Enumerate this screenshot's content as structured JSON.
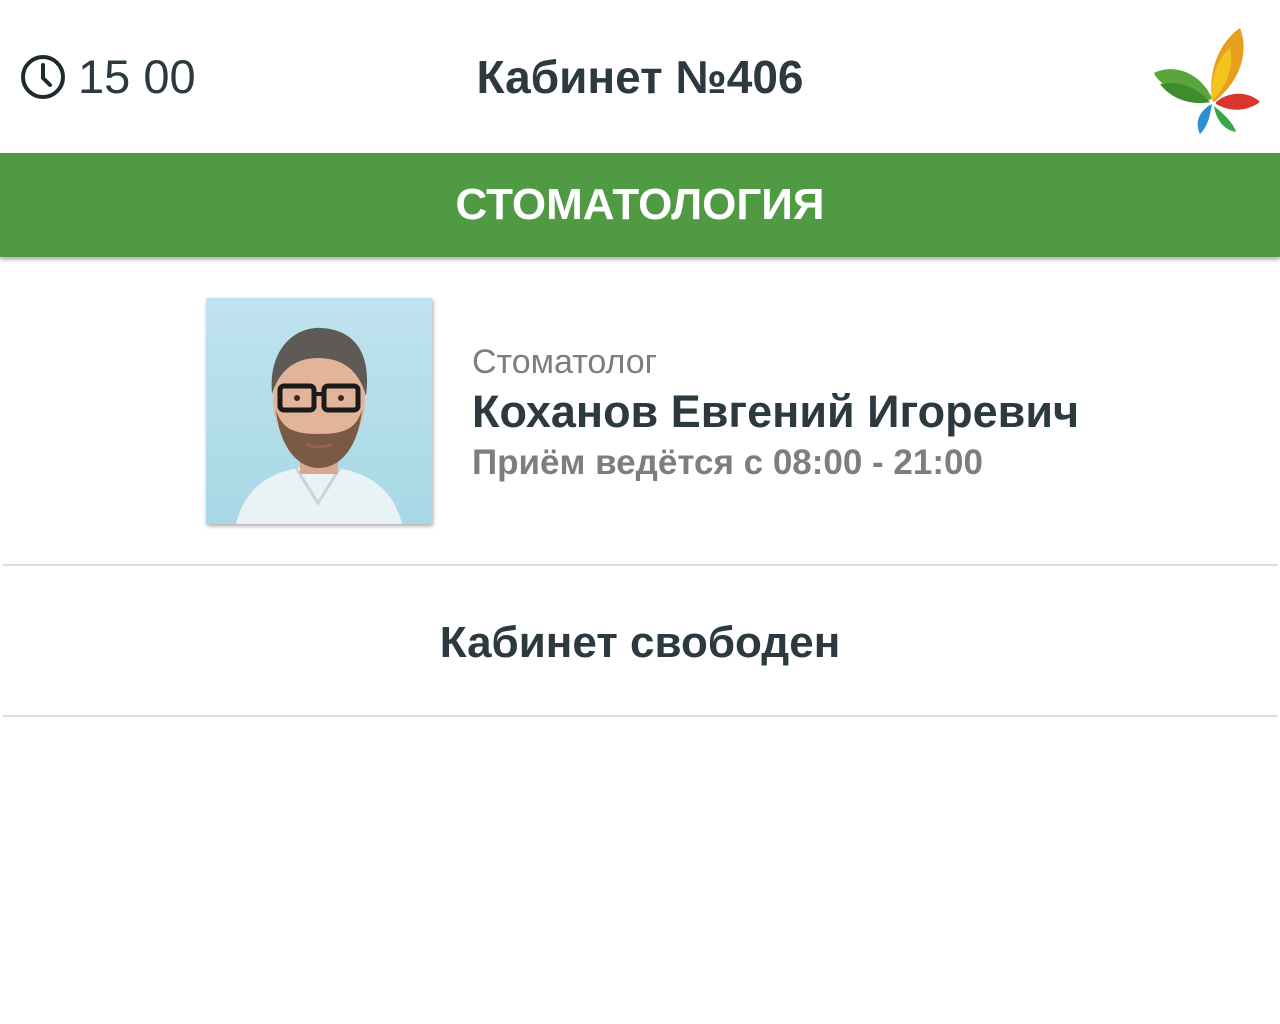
{
  "header": {
    "time": "15 00",
    "cabinet_title": "Кабинет №406",
    "clock_icon": "clock-icon",
    "logo_icon": "butterfly-logo-icon"
  },
  "department": {
    "name": "СТОМАТОЛОГИЯ",
    "color": "#4f9a43"
  },
  "doctor": {
    "role": "Стоматолог",
    "name": "Коханов Евгений Игоревич",
    "hours": "Приём ведётся с 08:00 - 21:00"
  },
  "status": {
    "text": "Кабинет свободен"
  },
  "colors": {
    "text_dark": "#2c3a3f",
    "text_muted": "#7b7f80",
    "divider": "#dcdddd"
  }
}
